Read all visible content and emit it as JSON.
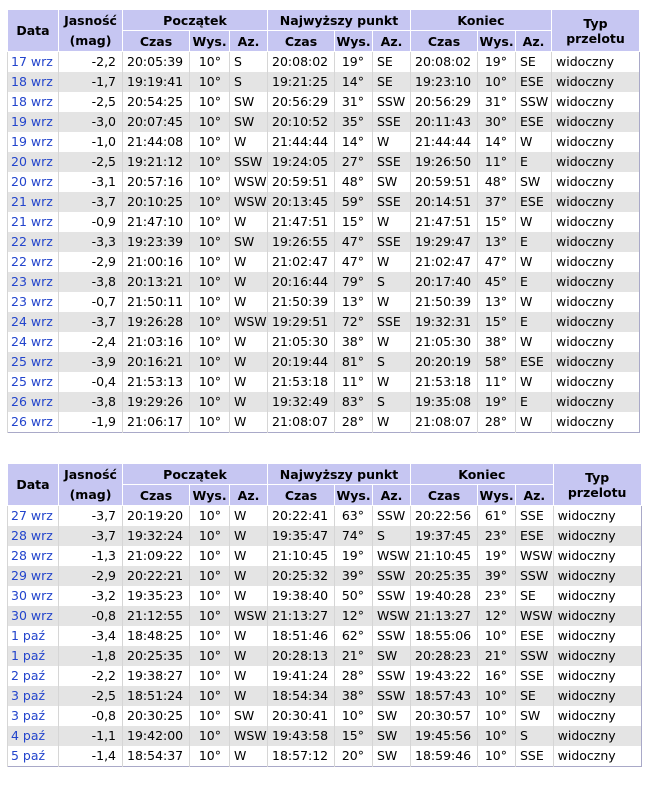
{
  "headers": {
    "data": "Data",
    "jasnosc": "Jasność",
    "mag": "(mag)",
    "poczatek": "Początek",
    "najwyzszy": "Najwyższy punkt",
    "koniec": "Koniec",
    "typ": "Typ przelotu",
    "czas": "Czas",
    "wys": "Wys.",
    "az": "Az."
  },
  "colors": {
    "header_bg": "#c6c6f2",
    "row_alt": "#e4e4e4",
    "link": "#2244cc"
  },
  "table1": [
    [
      "17 wrz",
      "-2,2",
      "20:05:39",
      "10°",
      "S",
      "20:08:02",
      "19°",
      "SE",
      "20:08:02",
      "19°",
      "SE",
      "widoczny"
    ],
    [
      "18 wrz",
      "-1,7",
      "19:19:41",
      "10°",
      "S",
      "19:21:25",
      "14°",
      "SE",
      "19:23:10",
      "10°",
      "ESE",
      "widoczny"
    ],
    [
      "18 wrz",
      "-2,5",
      "20:54:25",
      "10°",
      "SW",
      "20:56:29",
      "31°",
      "SSW",
      "20:56:29",
      "31°",
      "SSW",
      "widoczny"
    ],
    [
      "19 wrz",
      "-3,0",
      "20:07:45",
      "10°",
      "SW",
      "20:10:52",
      "35°",
      "SSE",
      "20:11:43",
      "30°",
      "ESE",
      "widoczny"
    ],
    [
      "19 wrz",
      "-1,0",
      "21:44:08",
      "10°",
      "W",
      "21:44:44",
      "14°",
      "W",
      "21:44:44",
      "14°",
      "W",
      "widoczny"
    ],
    [
      "20 wrz",
      "-2,5",
      "19:21:12",
      "10°",
      "SSW",
      "19:24:05",
      "27°",
      "SSE",
      "19:26:50",
      "11°",
      "E",
      "widoczny"
    ],
    [
      "20 wrz",
      "-3,1",
      "20:57:16",
      "10°",
      "WSW",
      "20:59:51",
      "48°",
      "SW",
      "20:59:51",
      "48°",
      "SW",
      "widoczny"
    ],
    [
      "21 wrz",
      "-3,7",
      "20:10:25",
      "10°",
      "WSW",
      "20:13:45",
      "59°",
      "SSE",
      "20:14:51",
      "37°",
      "ESE",
      "widoczny"
    ],
    [
      "21 wrz",
      "-0,9",
      "21:47:10",
      "10°",
      "W",
      "21:47:51",
      "15°",
      "W",
      "21:47:51",
      "15°",
      "W",
      "widoczny"
    ],
    [
      "22 wrz",
      "-3,3",
      "19:23:39",
      "10°",
      "SW",
      "19:26:55",
      "47°",
      "SSE",
      "19:29:47",
      "13°",
      "E",
      "widoczny"
    ],
    [
      "22 wrz",
      "-2,9",
      "21:00:16",
      "10°",
      "W",
      "21:02:47",
      "47°",
      "W",
      "21:02:47",
      "47°",
      "W",
      "widoczny"
    ],
    [
      "23 wrz",
      "-3,8",
      "20:13:21",
      "10°",
      "W",
      "20:16:44",
      "79°",
      "S",
      "20:17:40",
      "45°",
      "E",
      "widoczny"
    ],
    [
      "23 wrz",
      "-0,7",
      "21:50:11",
      "10°",
      "W",
      "21:50:39",
      "13°",
      "W",
      "21:50:39",
      "13°",
      "W",
      "widoczny"
    ],
    [
      "24 wrz",
      "-3,7",
      "19:26:28",
      "10°",
      "WSW",
      "19:29:51",
      "72°",
      "SSE",
      "19:32:31",
      "15°",
      "E",
      "widoczny"
    ],
    [
      "24 wrz",
      "-2,4",
      "21:03:16",
      "10°",
      "W",
      "21:05:30",
      "38°",
      "W",
      "21:05:30",
      "38°",
      "W",
      "widoczny"
    ],
    [
      "25 wrz",
      "-3,9",
      "20:16:21",
      "10°",
      "W",
      "20:19:44",
      "81°",
      "S",
      "20:20:19",
      "58°",
      "ESE",
      "widoczny"
    ],
    [
      "25 wrz",
      "-0,4",
      "21:53:13",
      "10°",
      "W",
      "21:53:18",
      "11°",
      "W",
      "21:53:18",
      "11°",
      "W",
      "widoczny"
    ],
    [
      "26 wrz",
      "-3,8",
      "19:29:26",
      "10°",
      "W",
      "19:32:49",
      "83°",
      "S",
      "19:35:08",
      "19°",
      "E",
      "widoczny"
    ],
    [
      "26 wrz",
      "-1,9",
      "21:06:17",
      "10°",
      "W",
      "21:08:07",
      "28°",
      "W",
      "21:08:07",
      "28°",
      "W",
      "widoczny"
    ]
  ],
  "table2": [
    [
      "27 wrz",
      "-3,7",
      "20:19:20",
      "10°",
      "W",
      "20:22:41",
      "63°",
      "SSW",
      "20:22:56",
      "61°",
      "SSE",
      "widoczny"
    ],
    [
      "28 wrz",
      "-3,7",
      "19:32:24",
      "10°",
      "W",
      "19:35:47",
      "74°",
      "S",
      "19:37:45",
      "23°",
      "ESE",
      "widoczny"
    ],
    [
      "28 wrz",
      "-1,3",
      "21:09:22",
      "10°",
      "W",
      "21:10:45",
      "19°",
      "WSW",
      "21:10:45",
      "19°",
      "WSW",
      "widoczny"
    ],
    [
      "29 wrz",
      "-2,9",
      "20:22:21",
      "10°",
      "W",
      "20:25:32",
      "39°",
      "SSW",
      "20:25:35",
      "39°",
      "SSW",
      "widoczny"
    ],
    [
      "30 wrz",
      "-3,2",
      "19:35:23",
      "10°",
      "W",
      "19:38:40",
      "50°",
      "SSW",
      "19:40:28",
      "23°",
      "SE",
      "widoczny"
    ],
    [
      "30 wrz",
      "-0,8",
      "21:12:55",
      "10°",
      "WSW",
      "21:13:27",
      "12°",
      "WSW",
      "21:13:27",
      "12°",
      "WSW",
      "widoczny"
    ],
    [
      "1 paź",
      "-3,4",
      "18:48:25",
      "10°",
      "W",
      "18:51:46",
      "62°",
      "SSW",
      "18:55:06",
      "10°",
      "ESE",
      "widoczny"
    ],
    [
      "1 paź",
      "-1,8",
      "20:25:35",
      "10°",
      "W",
      "20:28:13",
      "21°",
      "SW",
      "20:28:23",
      "21°",
      "SSW",
      "widoczny"
    ],
    [
      "2 paź",
      "-2,2",
      "19:38:27",
      "10°",
      "W",
      "19:41:24",
      "28°",
      "SSW",
      "19:43:22",
      "16°",
      "SSE",
      "widoczny"
    ],
    [
      "3 paź",
      "-2,5",
      "18:51:24",
      "10°",
      "W",
      "18:54:34",
      "38°",
      "SSW",
      "18:57:43",
      "10°",
      "SE",
      "widoczny"
    ],
    [
      "3 paź",
      "-0,8",
      "20:30:25",
      "10°",
      "SW",
      "20:30:41",
      "10°",
      "SW",
      "20:30:57",
      "10°",
      "SW",
      "widoczny"
    ],
    [
      "4 paź",
      "-1,1",
      "19:42:00",
      "10°",
      "WSW",
      "19:43:58",
      "15°",
      "SW",
      "19:45:56",
      "10°",
      "S",
      "widoczny"
    ],
    [
      "5 paź",
      "-1,4",
      "18:54:37",
      "10°",
      "W",
      "18:57:12",
      "20°",
      "SW",
      "18:59:46",
      "10°",
      "SSE",
      "widoczny"
    ]
  ]
}
